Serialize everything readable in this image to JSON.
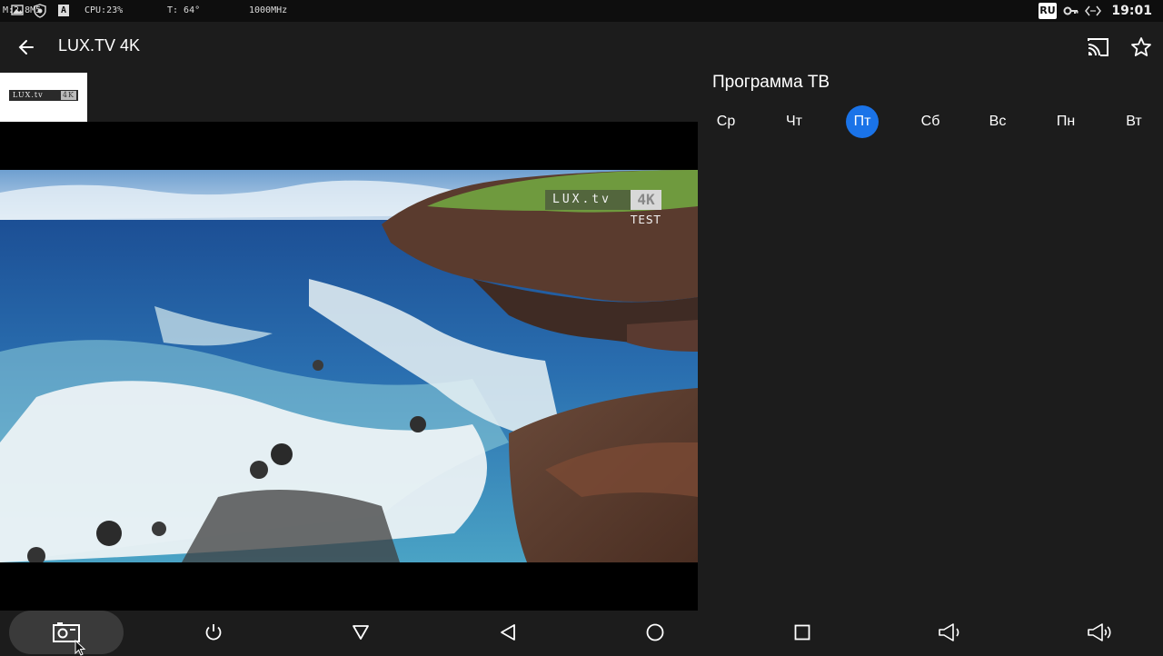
{
  "status_bar": {
    "mem": "M:2.8M5",
    "a_badge": "A",
    "cpu": "CPU:23%",
    "temp": "T: 64°",
    "freq": "1000MHz",
    "lang": "RU",
    "time": "19:01",
    "icons": [
      "image-icon",
      "shield-icon",
      "key-icon",
      "code-icon"
    ]
  },
  "app_bar": {
    "title": "LUX.TV 4K",
    "actions": [
      "cast-icon",
      "star-icon"
    ]
  },
  "channel_logo": {
    "text": "LUX.tv",
    "badge": "4K"
  },
  "video": {
    "watermark": "LUX.tv",
    "watermark_badge": "4K",
    "watermark_sub": "TEST"
  },
  "guide": {
    "title": "Программа ТВ",
    "days": [
      "Ср",
      "Чт",
      "Пт",
      "Сб",
      "Вс",
      "Пн",
      "Вт"
    ],
    "selected_day": "Пт"
  },
  "nav_bar": {
    "buttons": [
      "screenshot-icon",
      "power-icon",
      "hide-nav-icon",
      "back-icon",
      "home-icon",
      "recents-icon",
      "volume-down-icon",
      "volume-up-icon"
    ]
  },
  "colors": {
    "accent": "#1a73e8",
    "background": "#1c1c1c",
    "status_bar": "#0e0e0e"
  }
}
